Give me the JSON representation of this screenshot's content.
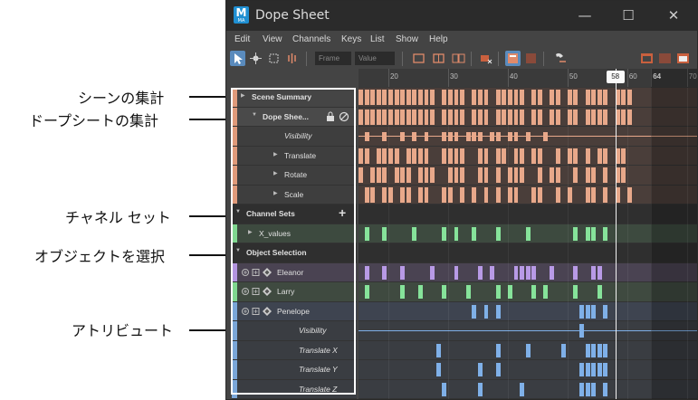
{
  "window": {
    "title": "Dope Sheet",
    "app_icon_letter": "M",
    "app_icon_sub": "MA",
    "controls": [
      "—",
      "☐",
      "✕"
    ]
  },
  "menu": [
    "Edit",
    "View",
    "Channels",
    "Keys",
    "List",
    "Show",
    "Help"
  ],
  "toolbar": {
    "frame_placeholder": "Frame",
    "value_placeholder": "Value"
  },
  "callouts": [
    {
      "text": "シーンの集計",
      "ghost": "Sce"
    },
    {
      "text": "ドープシートの集計",
      "ghost": "Dop"
    },
    {
      "text": "チャネル セット"
    },
    {
      "text": "オブジェクトを選択"
    },
    {
      "text": "アトリビュート"
    }
  ],
  "outliner": {
    "rows": [
      {
        "label": "Scene Summary",
        "indent": 22,
        "arrow": "▶",
        "strip": "#e09a7a",
        "bg": "#454545",
        "italic": false
      },
      {
        "label": "Dope Shee...",
        "indent": 34,
        "arrow": "▼",
        "strip": "#e09a7a",
        "bg": "#4a4a4a",
        "italic": false,
        "icons": [
          "lock-icon",
          "no-icon"
        ]
      },
      {
        "label": "Visibility",
        "indent": 58,
        "arrow": "",
        "strip": "#e09a7a",
        "bg": "#3e3e3e",
        "italic": true
      },
      {
        "label": "Translate",
        "indent": 58,
        "arrow": "▶",
        "strip": "#e09a7a",
        "bg": "#3e3e3e",
        "italic": false
      },
      {
        "label": "Rotate",
        "indent": 58,
        "arrow": "▶",
        "strip": "#e09a7a",
        "bg": "#3e3e3e",
        "italic": false
      },
      {
        "label": "Scale",
        "indent": 58,
        "arrow": "▶",
        "strip": "#e09a7a",
        "bg": "#3e3e3e",
        "italic": false
      },
      {
        "label": "Channel Sets",
        "indent": 16,
        "arrow": "▼",
        "strip": "",
        "bg": "#2f2f2f",
        "italic": false,
        "plus": "+"
      },
      {
        "label": "X_values",
        "indent": 30,
        "arrow": "▶",
        "strip": "#7fd68f",
        "bg": "#3d4a3f",
        "italic": false
      },
      {
        "label": "Object Selection",
        "indent": 16,
        "arrow": "▼",
        "strip": "",
        "bg": "#2f2f2f",
        "italic": false
      },
      {
        "label": "Eleanor",
        "indent": 50,
        "arrow": "",
        "strip": "#b394df",
        "bg": "#4a4352",
        "italic": false,
        "objicons": true
      },
      {
        "label": "Larry",
        "indent": 50,
        "arrow": "",
        "strip": "#7fd68f",
        "bg": "#3f4a40",
        "italic": false,
        "objicons": true
      },
      {
        "label": "Penelope",
        "indent": 50,
        "arrow": "",
        "strip": "#7aa6d8",
        "bg": "#3e4450",
        "italic": false,
        "objicons": true
      },
      {
        "label": "Visibility",
        "indent": 74,
        "arrow": "",
        "strip": "#7aa6d8",
        "bg": "#3a3d42",
        "italic": true
      },
      {
        "label": "Translate X",
        "indent": 74,
        "arrow": "",
        "strip": "#7aa6d8",
        "bg": "#3a3d42",
        "italic": true
      },
      {
        "label": "Translate Y",
        "indent": 74,
        "arrow": "",
        "strip": "#7aa6d8",
        "bg": "#3a3d42",
        "italic": true
      },
      {
        "label": "Translate Z",
        "indent": 74,
        "arrow": "",
        "strip": "#7aa6d8",
        "bg": "#3a3d42",
        "italic": true
      }
    ]
  },
  "timeline": {
    "ticks": [
      "20",
      "30",
      "40",
      "50",
      "60",
      "64",
      "70"
    ],
    "current_frame": "58",
    "frame_start": 15,
    "frame_end": 72,
    "range_end": 64,
    "colors": {
      "summary": "#e8a88a",
      "green": "#86e39a",
      "purple": "#b89ae6",
      "blue": "#7fb0e8"
    }
  }
}
